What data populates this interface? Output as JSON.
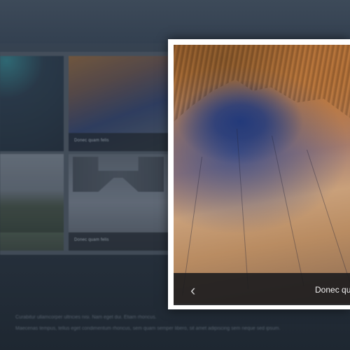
{
  "gallery": {
    "tiles": [
      {
        "caption": ""
      },
      {
        "caption": "Donec quam felis"
      },
      {
        "caption": ""
      },
      {
        "caption": "Donec quam felis"
      }
    ]
  },
  "footer": {
    "line1": "Curabitur ullamcorper ultricies nisi. Nam eget dui. Etiam rhoncus.",
    "line2": "Maecenas tempus, tellus eget condimentum rhoncus, sem quam semper libero, sit amet adipiscing sem neque sed ipsum."
  },
  "lightbox": {
    "caption": "Donec qu",
    "prev_icon": "chevron-left-icon"
  }
}
